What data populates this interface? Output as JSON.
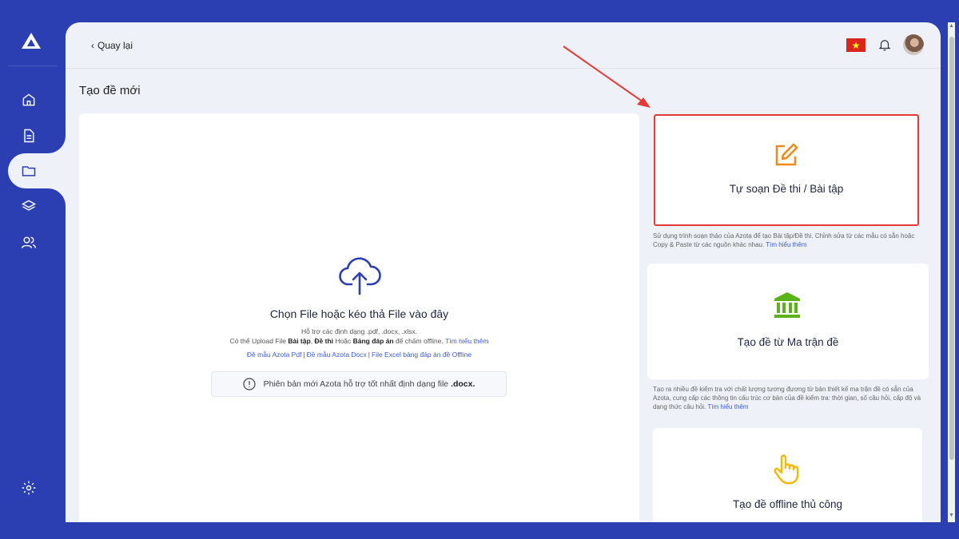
{
  "topbar": {
    "back_label": "Quay lại",
    "flag_star": "★"
  },
  "page": {
    "title": "Tạo đề mới"
  },
  "upload": {
    "title": "Chọn File hoặc kéo thả File vào đây",
    "formats": "Hỗ trợ các định dạng .pdf, .docx, .xlsx.",
    "hint_prefix": "Có thể Upload File ",
    "hint_bt": "Bài tập",
    "hint_comma": ", ",
    "hint_dt": "Đề thi",
    "hint_or": " Hoặc ",
    "hint_da": "Bảng đáp án",
    "hint_suffix": " để chấm offline. ",
    "learn_more": "Tìm hiểu thêm",
    "templates": [
      "Đề mẫu Azota Pdf",
      "Đề mẫu Azota Docx",
      "File Excel bảng đáp án đề Offline"
    ],
    "template_sep": "|",
    "notice_text": "Phiên bản mới Azota hỗ trợ tốt nhất định dạng file ",
    "notice_bold": ".docx."
  },
  "options": [
    {
      "title": "Tự soạn Đề thi / Bài tập",
      "desc": "Sử dụng trình soạn thảo của Azota để tạo Bài tập/Đề thi. Chỉnh sửa từ các mẫu có sẵn hoặc Copy & Paste từ các nguồn khác nhau. ",
      "link": "Tìm hiểu thêm",
      "icon": "edit-icon"
    },
    {
      "title": "Tạo đề từ Ma trận đề",
      "desc": "Tạo ra nhiều đề kiểm tra với chất lượng tương đương từ bản thiết kế ma trận đề có sẵn của Azota, cung cấp các thông tin cấu trúc cơ bản của đề kiểm tra: thời gian, số câu hỏi, cấp độ và dạng thức câu hỏi. ",
      "link": "Tìm hiểu thêm",
      "icon": "bank-icon"
    },
    {
      "title": "Tạo đề offline thủ công",
      "icon": "hand-pointer-icon"
    }
  ],
  "colors": {
    "brand": "#2b3fb3",
    "highlight": "#e53935",
    "edit_icon": "#f08a1c",
    "bank_icon": "#5bb318",
    "hand_icon": "#f5b800"
  }
}
